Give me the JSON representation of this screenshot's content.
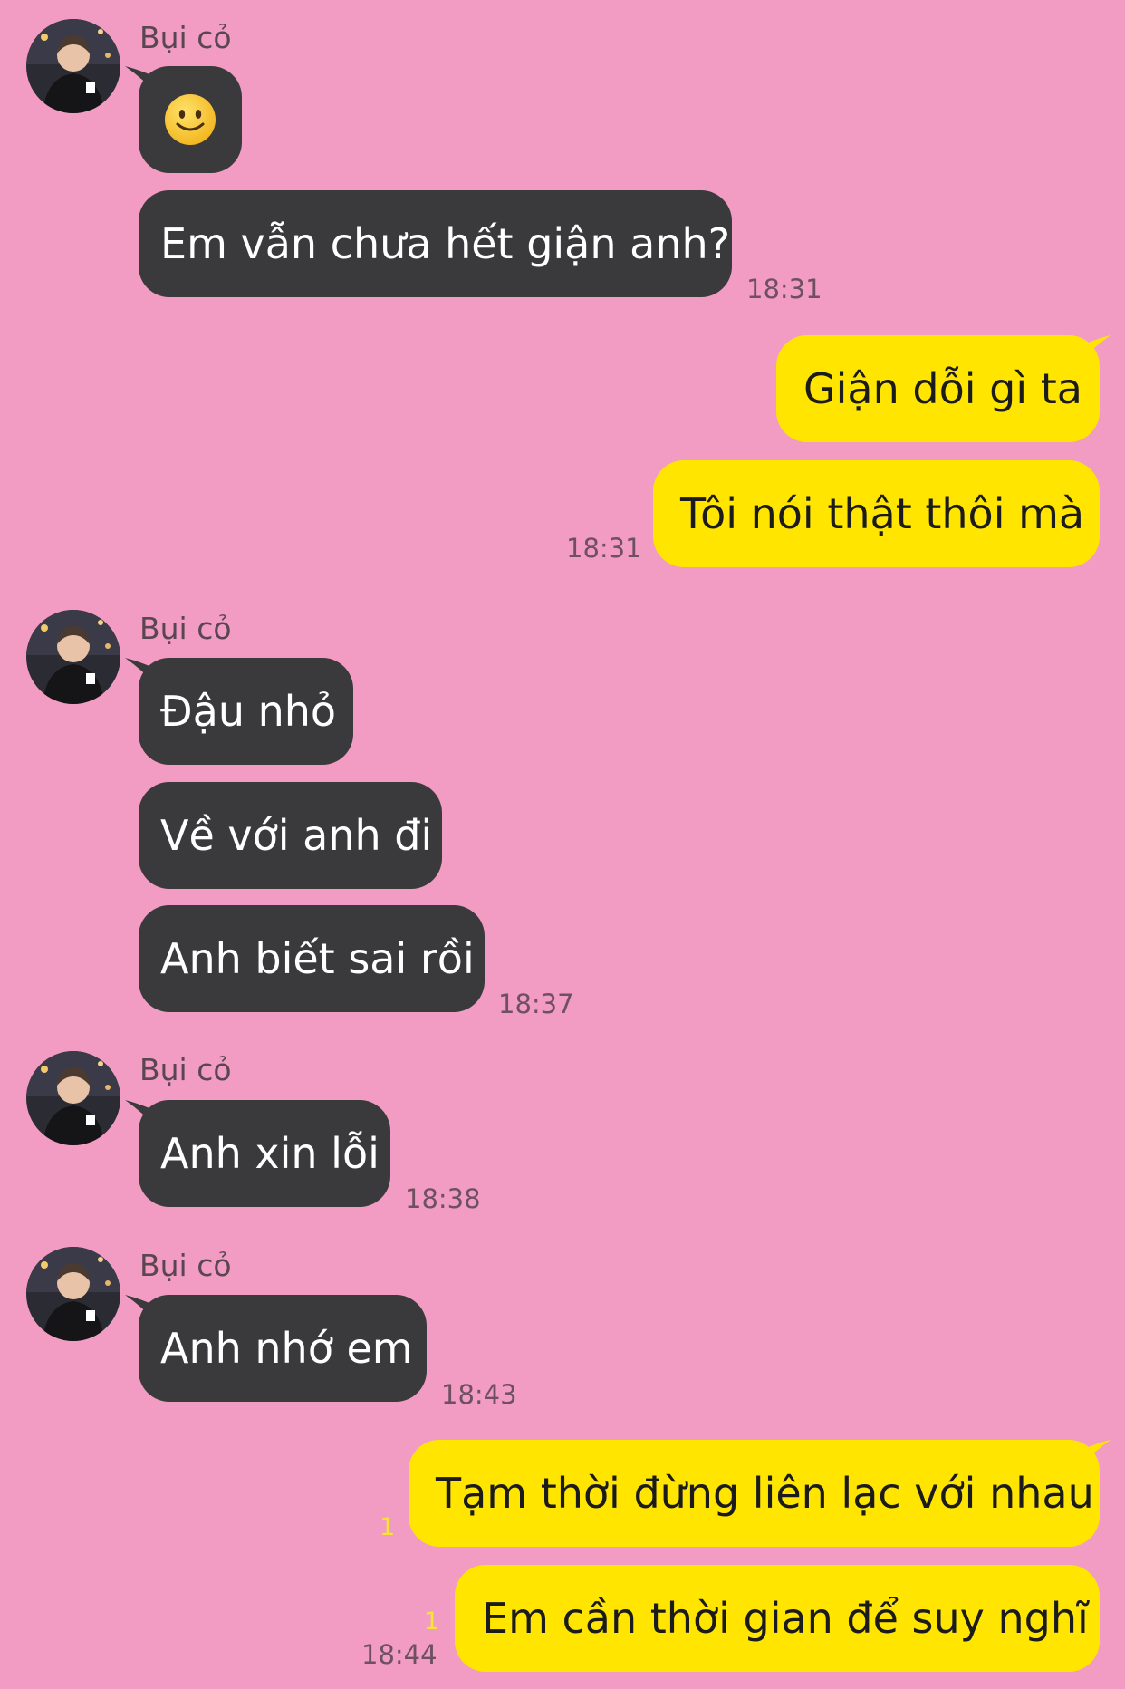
{
  "contact": {
    "name": "Bụi cỏ"
  },
  "colors": {
    "background": "#f29cc3",
    "incoming_bubble": "#3a3a3c",
    "outgoing_bubble": "#ffe500",
    "unread_indicator": "#f7e531"
  },
  "groups": [
    {
      "sender": "Bụi cỏ",
      "messages": [
        {
          "emoji": "slightly-smiling-face"
        },
        {
          "text": "Em vẫn chưa hết giận anh?"
        }
      ],
      "time": "18:31"
    },
    {
      "sender": "me",
      "messages": [
        {
          "text": "Giận dỗi gì ta"
        },
        {
          "text": "Tôi nói thật thôi mà"
        }
      ],
      "time": "18:31"
    },
    {
      "sender": "Bụi cỏ",
      "messages": [
        {
          "text": "Đậu nhỏ"
        },
        {
          "text": "Về với anh đi"
        },
        {
          "text": "Anh biết sai rồi"
        }
      ],
      "time": "18:37"
    },
    {
      "sender": "Bụi cỏ",
      "messages": [
        {
          "text": "Anh xin lỗi"
        }
      ],
      "time": "18:38"
    },
    {
      "sender": "Bụi cỏ",
      "messages": [
        {
          "text": "Anh nhớ em"
        }
      ],
      "time": "18:43"
    },
    {
      "sender": "me",
      "messages": [
        {
          "text": "Tạm thời đừng liên lạc với nhau",
          "unread": "1"
        },
        {
          "text": "Em cần thời gian để suy nghĩ",
          "unread": "1"
        }
      ],
      "time": "18:44"
    }
  ]
}
